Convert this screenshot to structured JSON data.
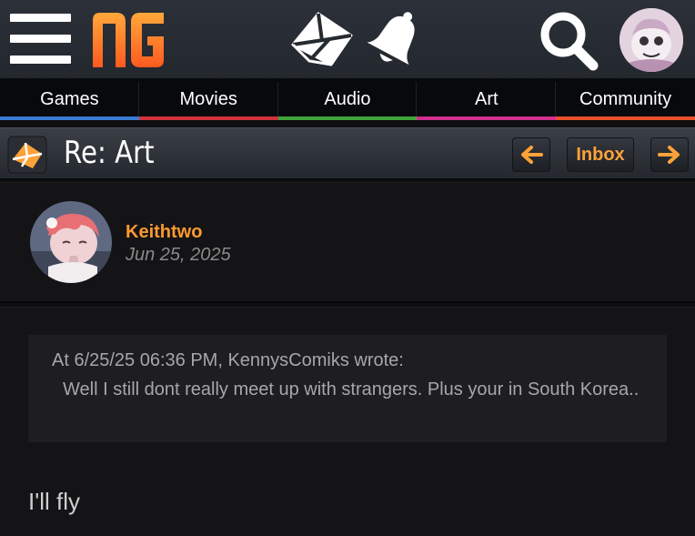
{
  "header": {
    "logo_text": "NG"
  },
  "nav": {
    "tabs": [
      {
        "label": "Games",
        "color": "#3a7bd5"
      },
      {
        "label": "Movies",
        "color": "#d0333b"
      },
      {
        "label": "Audio",
        "color": "#3fa53a"
      },
      {
        "label": "Art",
        "color": "#d0308e"
      },
      {
        "label": "Community",
        "color": "#e8502b"
      }
    ]
  },
  "page": {
    "title": "Re: Art",
    "inbox_label": "Inbox",
    "accent_color": "#fda238"
  },
  "post": {
    "author": "Keithtwo",
    "date": "Jun 25, 2025",
    "quote_cite": "At 6/25/25 06:36 PM, KennysComiks wrote:",
    "quote_text": "Well I still dont really meet up with strangers. Plus your in South Korea..",
    "message": "I'll fly"
  }
}
